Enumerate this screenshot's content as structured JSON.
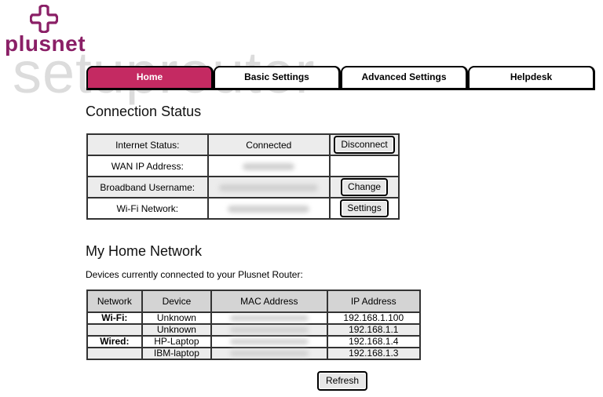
{
  "watermark": "setuprouter",
  "brand": {
    "name": "plusnet",
    "color": "#8a1f66",
    "accent": "#c42a62"
  },
  "tabs": [
    {
      "label": "Home",
      "active": true
    },
    {
      "label": "Basic Settings",
      "active": false
    },
    {
      "label": "Advanced Settings",
      "active": false
    },
    {
      "label": "Helpdesk",
      "active": false
    }
  ],
  "connection": {
    "title": "Connection Status",
    "rows": [
      {
        "label": "Internet Status:",
        "value": "Connected",
        "action": "Disconnect",
        "value_blurred": false
      },
      {
        "label": "WAN IP Address:",
        "value": "",
        "action": "",
        "value_blurred": true
      },
      {
        "label": "Broadband Username:",
        "value": "",
        "action": "Change",
        "value_blurred": true
      },
      {
        "label": "Wi-Fi Network:",
        "value": "",
        "action": "Settings",
        "value_blurred": true
      }
    ]
  },
  "home_network": {
    "title": "My Home Network",
    "subtitle": "Devices currently connected to your Plusnet Router:",
    "columns": [
      "Network",
      "Device",
      "MAC Address",
      "IP Address"
    ],
    "rows": [
      {
        "network": "Wi-Fi:",
        "device": "Unknown",
        "mac": "",
        "ip": "192.168.1.100"
      },
      {
        "network": "",
        "device": "Unknown",
        "mac": "",
        "ip": "192.168.1.1"
      },
      {
        "network": "Wired:",
        "device": "HP-Laptop",
        "mac": "",
        "ip": "192.168.1.4"
      },
      {
        "network": "",
        "device": "IBM-laptop",
        "mac": "",
        "ip": "192.168.1.3"
      }
    ],
    "refresh_label": "Refresh"
  }
}
